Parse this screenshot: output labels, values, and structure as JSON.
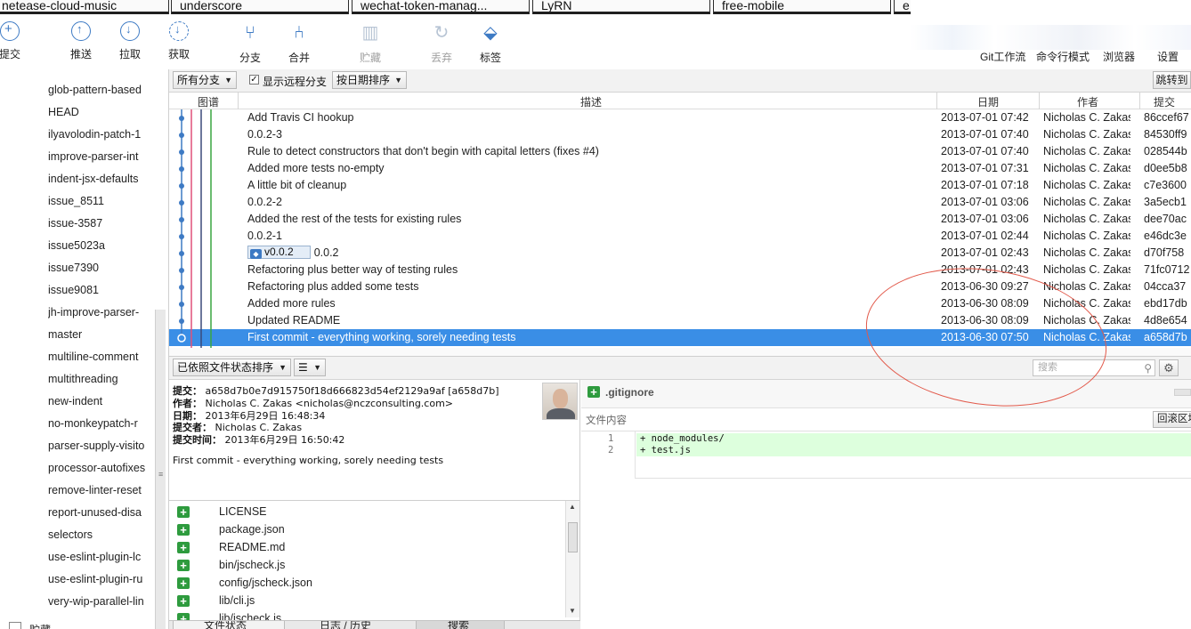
{
  "tabs": [
    "netease-cloud-music",
    "underscore",
    "wechat-token-manag...",
    "LyRN",
    "free-mobile",
    "e"
  ],
  "toolbar": {
    "commit": "提交",
    "push": "推送",
    "pull": "拉取",
    "fetch": "获取",
    "branch": "分支",
    "merge": "合并",
    "stash": "贮藏",
    "discard": "丢弃",
    "tag": "标签",
    "git_flow": "Git工作流",
    "terminal": "命令行模式",
    "browser": "浏览器",
    "settings": "设置"
  },
  "sidebar": {
    "branches": [
      "glob-pattern-based",
      "HEAD",
      "ilyavolodin-patch-1",
      "improve-parser-int",
      "indent-jsx-defaults",
      "issue_8511",
      "issue-3587",
      "issue5023a",
      "issue7390",
      "issue9081",
      "jh-improve-parser-",
      "master",
      "multiline-comment",
      "multithreading",
      "new-indent",
      "no-monkeypatch-r",
      "parser-supply-visito",
      "processor-autofixes",
      "remove-linter-reset",
      "report-unused-disa",
      "selectors",
      "use-eslint-plugin-lc",
      "use-eslint-plugin-ru",
      "very-wip-parallel-lin"
    ],
    "bottom_label": "贮藏"
  },
  "filter": {
    "branches": "所有分支",
    "show_remote": "显示远程分支",
    "show_remote_checked": true,
    "sort": "按日期排序",
    "jump": "跳转到"
  },
  "columns": {
    "graph": "图谱",
    "desc": "描述",
    "date": "日期",
    "author": "作者",
    "commit": "提交"
  },
  "commits": [
    {
      "desc": "Add Travis CI hookup",
      "date": "2013-07-01 07:42",
      "author": "Nicholas C. Zakas",
      "hash": "86ccef67"
    },
    {
      "desc": "0.0.2-3",
      "date": "2013-07-01 07:40",
      "author": "Nicholas C. Zakas",
      "hash": "84530ff9"
    },
    {
      "desc": "Rule to detect constructors that don't begin with capital letters (fixes #4)",
      "date": "2013-07-01 07:40",
      "author": "Nicholas C. Zakas",
      "hash": "028544b"
    },
    {
      "desc": "Added more tests no-empty",
      "date": "2013-07-01 07:31",
      "author": "Nicholas C. Zakas",
      "hash": "d0ee5b8"
    },
    {
      "desc": "A little bit of cleanup",
      "date": "2013-07-01 07:18",
      "author": "Nicholas C. Zakas",
      "hash": "c7e3600"
    },
    {
      "desc": "0.0.2-2",
      "date": "2013-07-01 03:06",
      "author": "Nicholas C. Zakas",
      "hash": "3a5ecb1"
    },
    {
      "desc": "Added the rest of the tests for existing rules",
      "date": "2013-07-01 03:06",
      "author": "Nicholas C. Zakas",
      "hash": "dee70ac"
    },
    {
      "desc": "0.0.2-1",
      "date": "2013-07-01 02:44",
      "author": "Nicholas C. Zakas",
      "hash": "e46dc3e"
    },
    {
      "desc": "0.0.2",
      "tag": "v0.0.2",
      "date": "2013-07-01 02:43",
      "author": "Nicholas C. Zakas",
      "hash": "d70f758"
    },
    {
      "desc": "Refactoring plus better way of testing rules",
      "date": "2013-07-01 02:43",
      "author": "Nicholas C. Zakas",
      "hash": "71fc0712"
    },
    {
      "desc": "Refactoring plus added some tests",
      "date": "2013-06-30 09:27",
      "author": "Nicholas C. Zakas",
      "hash": "04cca37"
    },
    {
      "desc": "Added more rules",
      "date": "2013-06-30 08:09",
      "author": "Nicholas C. Zakas",
      "hash": "ebd17db"
    },
    {
      "desc": "Updated README",
      "date": "2013-06-30 08:09",
      "author": "Nicholas C. Zakas",
      "hash": "4d8e654"
    },
    {
      "desc": "First commit - everything working, sorely needing tests",
      "date": "2013-06-30 07:50",
      "author": "Nicholas C. Zakas",
      "hash": "a658d7b",
      "selected": true
    }
  ],
  "lower": {
    "sort": "已依照文件状态排序",
    "view": "☰",
    "search_placeholder": "搜索"
  },
  "details": {
    "commit_label": "提交：",
    "commit": "a658d7b0e7d915750f18d666823d54ef2129a9af [a658d7b]",
    "author_label": "作者：",
    "author": "Nicholas C. Zakas <nicholas@nczconsulting.com>",
    "date_label": "日期：",
    "date": "2013年6月29日 16:48:34",
    "committer_label": "提交者：",
    "committer": "Nicholas C. Zakas",
    "commit_time_label": "提交时间：",
    "commit_time": "2013年6月29日 16:50:42",
    "message": "First commit - everything working, sorely needing tests"
  },
  "files": [
    "LICENSE",
    "package.json",
    "README.md",
    "bin/jscheck.js",
    "config/jscheck.json",
    "lib/cli.js",
    "lib/jscheck.js"
  ],
  "bottom_tabs": [
    "文件状态",
    "日志 / 历史",
    "搜索"
  ],
  "diff": {
    "file": ".gitignore",
    "subtitle": "文件内容",
    "revert": "回滚区块",
    "lines": [
      {
        "n": "1",
        "text": "+ node_modules/"
      },
      {
        "n": "2",
        "text": "+ test.js"
      }
    ]
  },
  "colors": {
    "selection": "#3a8ee6",
    "accent": "#3d7ac4",
    "added": "#2e9b3e",
    "annotation": "#e2594a"
  }
}
